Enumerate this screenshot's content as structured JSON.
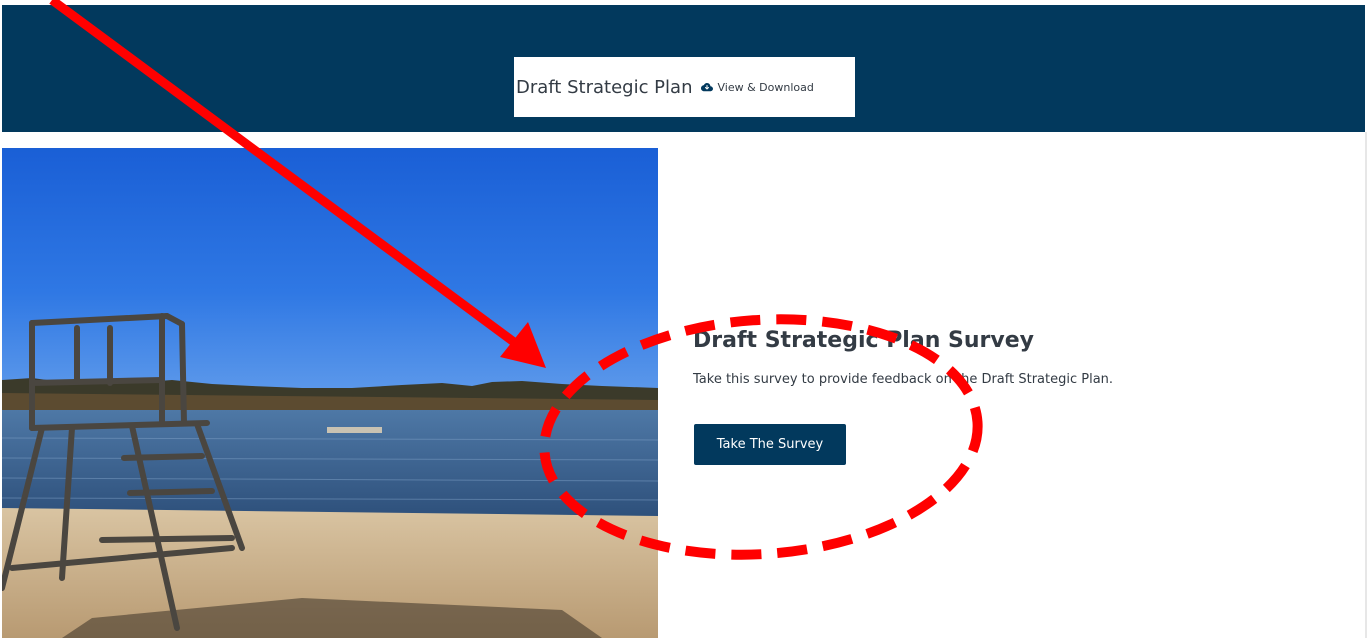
{
  "banner": {
    "plan_title": "Draft Strategic Plan",
    "download_icon": "cloud-download-icon",
    "download_label": "View & Download",
    "background_color": "#02395d"
  },
  "hero_image": {
    "subject": "lifeguard-chair-on-beach-by-lake"
  },
  "survey": {
    "heading": "Draft Strategic Plan Survey",
    "description": "Take this survey to provide feedback on the Draft Strategic Plan.",
    "button_label": "Take The Survey"
  },
  "annotation": {
    "arrow_color": "#ff0000",
    "ellipse_color": "#ff0000",
    "ellipse_style": "dashed"
  }
}
